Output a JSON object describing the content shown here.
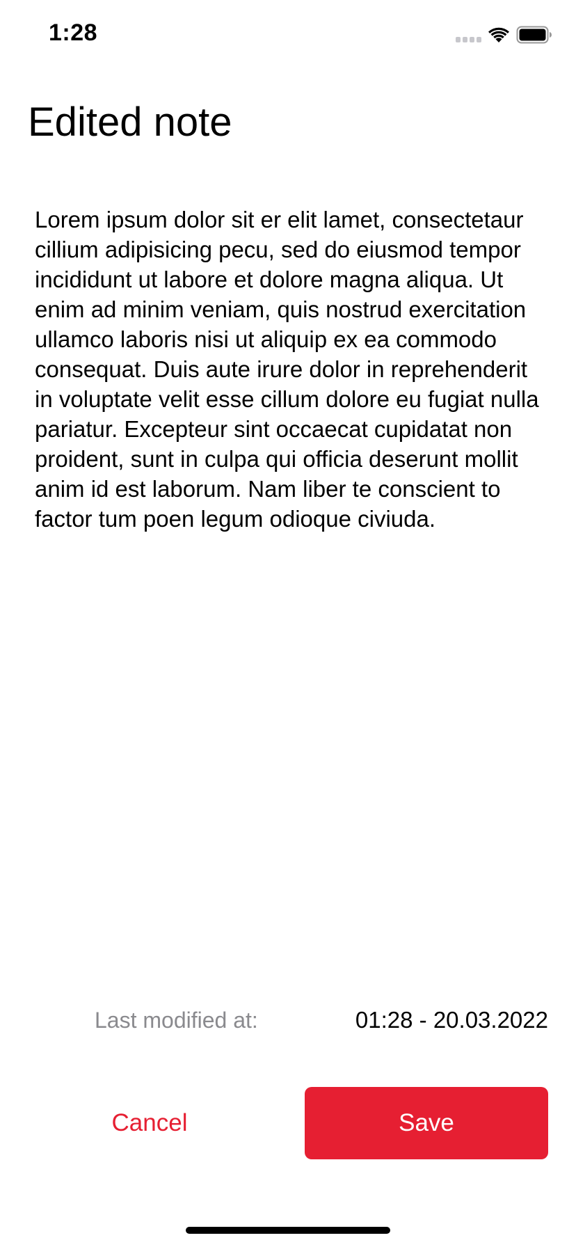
{
  "status_bar": {
    "time": "1:28",
    "icons": [
      "signal-icon",
      "wifi-icon",
      "battery-icon"
    ]
  },
  "note": {
    "title": "Edited note",
    "body": "Lorem ipsum dolor sit er elit lamet, consectetaur cillium adipisicing pecu, sed do eiusmod tempor incididunt ut labore et dolore magna aliqua. Ut enim ad minim veniam, quis nostrud exercitation ullamco laboris nisi ut aliquip ex ea commodo consequat. Duis aute irure dolor in reprehenderit in voluptate velit esse cillum dolore eu fugiat nulla pariatur. Excepteur sint occaecat cupidatat non proident, sunt in culpa qui officia deserunt mollit anim id est laborum. Nam liber te conscient to factor tum poen legum odioque civiuda."
  },
  "modified": {
    "label": "Last modified at:",
    "value": "01:28 - 20.03.2022"
  },
  "actions": {
    "cancel_label": "Cancel",
    "save_label": "Save"
  },
  "colors": {
    "accent": "#e61f32",
    "secondary_text": "#8a8a8e",
    "background": "#ffffff"
  }
}
